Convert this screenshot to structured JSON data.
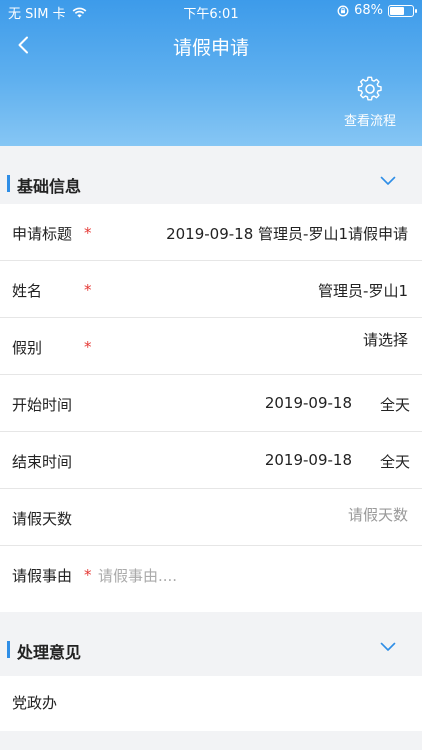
{
  "status_bar": {
    "carrier": "无 SIM 卡",
    "time": "下午6:01",
    "battery": "68%",
    "battery_level": 0.68
  },
  "nav": {
    "title": "请假申请",
    "flow_label": "查看流程"
  },
  "basic_section": {
    "title": "基础信息"
  },
  "fields": {
    "title_row": {
      "label": "申请标题",
      "value": "2019-09-18 管理员-罗山1请假申请"
    },
    "name_row": {
      "label": "姓名",
      "value": "管理员-罗山1"
    },
    "type_row": {
      "label": "假别",
      "value": "请选择"
    },
    "start_row": {
      "label": "开始时间",
      "date": "2019-09-18",
      "period": "全天"
    },
    "end_row": {
      "label": "结束时间",
      "date": "2019-09-18",
      "period": "全天"
    },
    "days_row": {
      "label": "请假天数",
      "placeholder": "请假天数"
    },
    "reason_row": {
      "label": "请假事由",
      "placeholder": "请假事由...."
    }
  },
  "required_mark": "*",
  "opinion_section": {
    "title": "处理意见",
    "dept_label": "党政办"
  },
  "colors": {
    "accent": "#2f8ee6",
    "required": "#e53935",
    "header_top": "#3d9bea"
  }
}
